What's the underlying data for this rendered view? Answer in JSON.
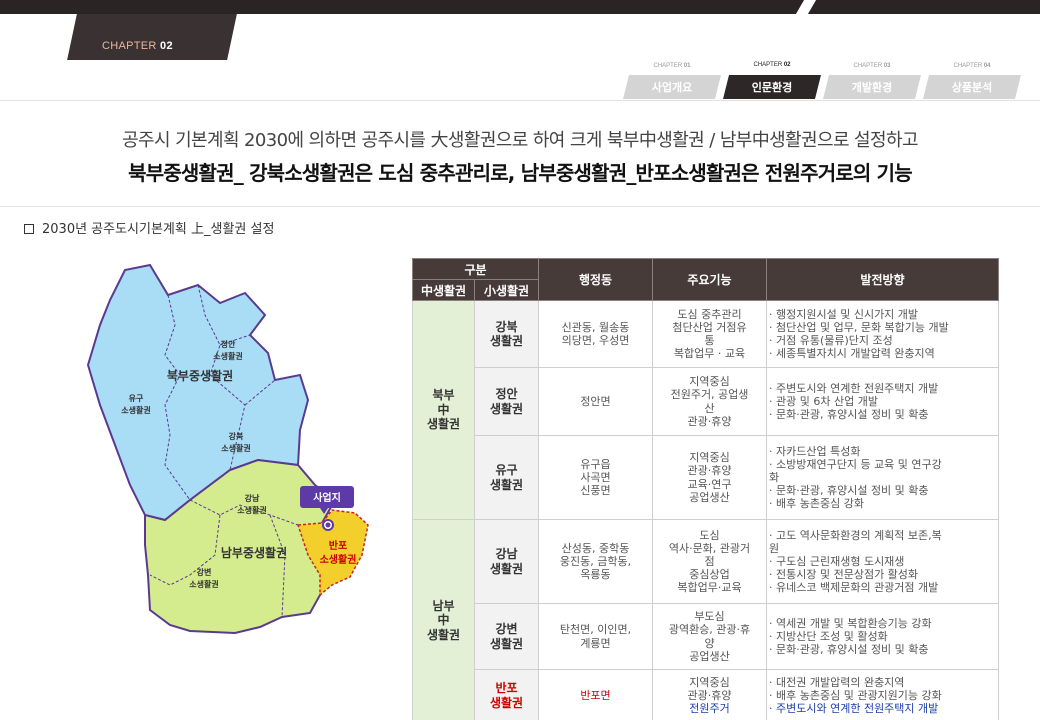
{
  "header": {
    "chapter_prefix": "CHAPTER",
    "chapter_number": "02",
    "nav": [
      {
        "small_prefix": "CHAPTER",
        "small_number": "01",
        "label": "사업개요",
        "active": false
      },
      {
        "small_prefix": "CHAPTER",
        "small_number": "02",
        "label": "인문환경",
        "active": true
      },
      {
        "small_prefix": "CHAPTER",
        "small_number": "03",
        "label": "개발환경",
        "active": false
      },
      {
        "small_prefix": "CHAPTER",
        "small_number": "04",
        "label": "상품분석",
        "active": false
      }
    ]
  },
  "headline": {
    "line1": "공주시 기본계획 2030에 의하면 공주시를 大생활권으로 하여 크게 북부中생활권 / 남부中생활권으로 설정하고",
    "line2": "북부중생활권_ 강북소생활권은 도심 중추관리로, 남부중생활권_반포소생활권은 전원주거로의 기능"
  },
  "section_title": "2030년 공주도시기본계획 上_생활권 설정",
  "map": {
    "labels": {
      "north_mid": "북부중생활권",
      "south_mid": "남부중생활권",
      "jeongan": [
        "정안",
        "소생활권"
      ],
      "yugu": [
        "유구",
        "소생활권"
      ],
      "gangbuk": [
        "강북",
        "소생활권"
      ],
      "gangnam": [
        "강남",
        "소생활권"
      ],
      "gangbyeon": [
        "강변",
        "소생활권"
      ],
      "banpo": [
        "반포",
        "소생활권"
      ]
    },
    "site_label": "사업지",
    "colors": {
      "north": "#a9dcf5",
      "south": "#d4ec8e",
      "banpo": "#f3cf2c",
      "boundary": "#5a3a8f"
    }
  },
  "table": {
    "headers": {
      "group": "구분",
      "mid": "中생활권",
      "small": "小생활권",
      "admin": "행정동",
      "function": "주요기능",
      "direction": "발전방향"
    },
    "mid_areas": [
      {
        "name": "북부\n中\n생활권"
      },
      {
        "name": "남부\n中\n생활권"
      }
    ],
    "rows": [
      {
        "area": "강북\n생활권",
        "admin": "신관동, 월송동\n의당면, 우성면",
        "function": "도심 중추관리\n첨단산업 거점유\n통\n복합업무 · 교육",
        "direction": [
          "· 행정지원시설 및 신시가지 개발",
          "· 첨단산업 및 업무, 문화 복합기능 개발",
          "· 거점 유통(물류)단지 조성",
          "· 세종특별자치시 개발압력 완충지역"
        ]
      },
      {
        "area": "정안\n생활권",
        "admin": "정안면",
        "function": "지역중심\n전원주거, 공업생\n산\n관광·휴양",
        "direction": [
          "· 주변도시와 연계한 전원주택지 개발",
          "· 관광 및 6차 산업 개발",
          "· 문화·관광, 휴양시설 정비 및 확충"
        ]
      },
      {
        "area": "유구\n생활권",
        "admin": "유구읍\n사곡면\n신풍면",
        "function": "지역중심\n관광·휴양\n교육·연구\n공업생산",
        "direction": [
          "· 자카드산업 특성화",
          "· 소방방재연구단지 등 교육 및 연구강",
          "화",
          "· 문화·관광, 휴양시설 정비 및 확충",
          "· 배후 농촌중심 강화"
        ]
      },
      {
        "area": "강남\n생활권",
        "admin": "산성동, 중학동\n웅진동, 금학동,\n옥룡동",
        "function": "도심\n역사·문화, 관광거\n점\n중심상업\n복합업무·교육",
        "direction": [
          "· 고도 역사문화환경의 계획적 보존,복",
          "원",
          "· 구도심 근린재생형 도시재생",
          "· 전통시장 및 전문상점가 활성화",
          "· 유네스코 백제문화의 관광거점 개발"
        ]
      },
      {
        "area": "강변\n생활권",
        "admin": "탄천면, 이인면,\n계룡면",
        "function": "부도심\n광역환승, 관광·휴\n양\n공업생산",
        "direction": [
          "· 역세권 개발 및 복합환승기능 강화",
          "· 지방산단 조성 및 활성화",
          "· 문화·관광, 휴양시설 정비 및 확충"
        ]
      },
      {
        "area": "반포\n생활권",
        "admin": "반포면",
        "function_lines": [
          "지역중심",
          "관광·휴양",
          "전원주거"
        ],
        "direction": [
          "· 대전권 개발압력의 완충지역",
          "· 배후 농촌중심 및 관광지원기능 강화",
          "· 주변도시와 연계한 전원주택지 개발"
        ]
      }
    ]
  }
}
